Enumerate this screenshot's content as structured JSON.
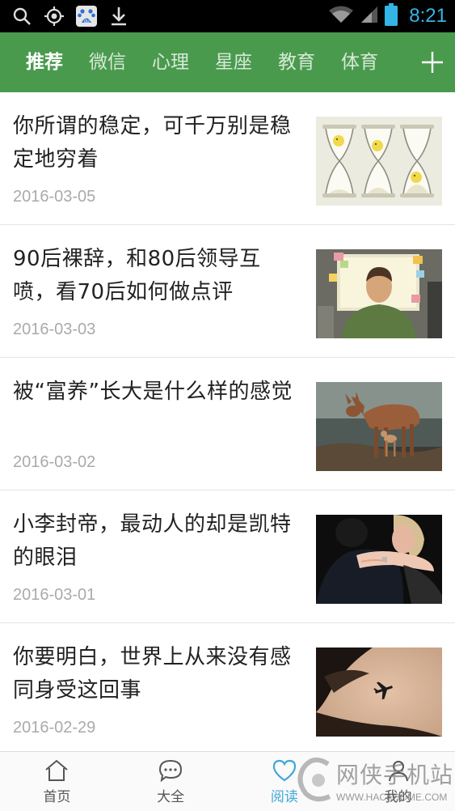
{
  "status_bar": {
    "time": "8:21",
    "left_icons": [
      "search-icon",
      "gps-icon",
      "baidu-icon",
      "download-icon"
    ],
    "right_icons": [
      "wifi-icon",
      "signal-icon",
      "battery-icon"
    ],
    "baidu_label": "du"
  },
  "top_tabs": {
    "items": [
      {
        "label": "推荐",
        "active": true
      },
      {
        "label": "微信",
        "active": false
      },
      {
        "label": "心理",
        "active": false
      },
      {
        "label": "星座",
        "active": false
      },
      {
        "label": "教育",
        "active": false
      },
      {
        "label": "体育",
        "active": false
      }
    ],
    "add_icon": "plus-icon"
  },
  "articles": [
    {
      "title": "你所谓的稳定，可千万别是稳定地穷着",
      "date": "2016-03-05",
      "thumb": "hourglass-image"
    },
    {
      "title": "90后裸辞，和80后领导互喷，看70后如何做点评",
      "date": "2016-03-03",
      "thumb": "office-worker-image"
    },
    {
      "title": "被“富养”长大是什么样的感觉",
      "date": "2016-03-02",
      "thumb": "deer-image"
    },
    {
      "title": "小李封帝，最动人的却是凯特的眼泪",
      "date": "2016-03-01",
      "thumb": "hug-image"
    },
    {
      "title": "你要明白，世界上从来没有感同身受这回事",
      "date": "2016-02-29",
      "thumb": "airplane-hand-image"
    }
  ],
  "bottom_nav": {
    "items": [
      {
        "label": "首页",
        "icon": "home-icon",
        "active": false
      },
      {
        "label": "大全",
        "icon": "chat-bubble-icon",
        "active": false
      },
      {
        "label": "阅读",
        "icon": "heart-icon",
        "active": true
      },
      {
        "label": "我的",
        "icon": "user-icon",
        "active": false
      }
    ]
  },
  "watermark": {
    "text": "网侠手机站",
    "url": "WWW.HACKHOME.COM"
  },
  "colors": {
    "accent_green": "#4a9a4e",
    "active_blue": "#3ea9d8",
    "time_blue": "#33b5e5"
  }
}
